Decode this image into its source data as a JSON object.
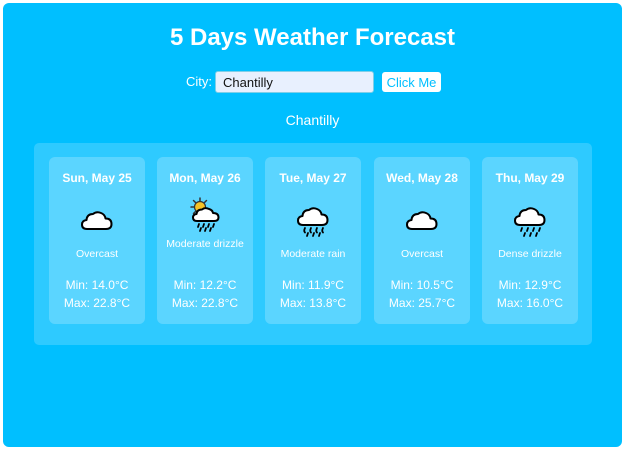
{
  "header": {
    "title": "5 Days Weather Forecast"
  },
  "search": {
    "label": "City:",
    "value": "Chantilly",
    "button_label": "Click Me"
  },
  "location": {
    "name": "Chantilly"
  },
  "colors": {
    "background": "#00bfff",
    "text": "#ffffff"
  },
  "forecast": [
    {
      "day": "Sun, May 25",
      "icon": "cloud-icon",
      "description": "Overcast",
      "min": "Min: 14.0°C",
      "max": "Max: 22.8°C"
    },
    {
      "day": "Mon, May 26",
      "icon": "sun-cloud-drizzle-icon",
      "description": "Moderate drizzle",
      "min": "Min: 12.2°C",
      "max": "Max: 22.8°C"
    },
    {
      "day": "Tue, May 27",
      "icon": "cloud-rain-icon",
      "description": "Moderate rain",
      "min": "Min: 11.9°C",
      "max": "Max: 13.8°C"
    },
    {
      "day": "Wed, May 28",
      "icon": "cloud-icon",
      "description": "Overcast",
      "min": "Min: 10.5°C",
      "max": "Max: 25.7°C"
    },
    {
      "day": "Thu, May 29",
      "icon": "cloud-drizzle-icon",
      "description": "Dense drizzle",
      "min": "Min: 12.9°C",
      "max": "Max: 16.0°C"
    }
  ]
}
